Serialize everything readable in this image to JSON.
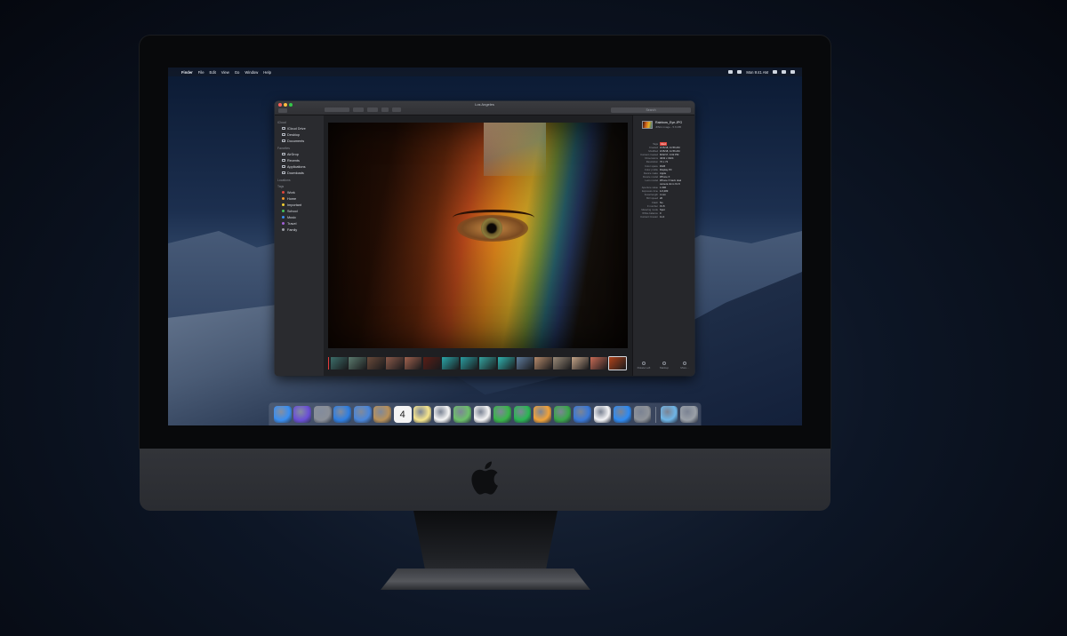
{
  "menubar": {
    "app_name": "Finder",
    "menus": [
      "File",
      "Edit",
      "View",
      "Go",
      "Window",
      "Help"
    ],
    "clock": "Mon 9:41 AM"
  },
  "window": {
    "title": "Los Angeles",
    "search_placeholder": "Search"
  },
  "sidebar": {
    "sections": [
      {
        "heading": "iCloud",
        "items": [
          {
            "label": "iCloud Drive",
            "icon": "cloud-icon"
          },
          {
            "label": "Desktop",
            "icon": "desktop-icon"
          },
          {
            "label": "Documents",
            "icon": "documents-icon"
          }
        ]
      },
      {
        "heading": "Favorites",
        "items": [
          {
            "label": "AirDrop",
            "icon": "airdrop-icon"
          },
          {
            "label": "Recents",
            "icon": "clock-icon"
          },
          {
            "label": "Applications",
            "icon": "applications-icon"
          },
          {
            "label": "Downloads",
            "icon": "download-icon"
          }
        ]
      },
      {
        "heading": "Locations",
        "items": []
      },
      {
        "heading": "Tags",
        "items": [
          {
            "label": "Work",
            "color": "#e0453c"
          },
          {
            "label": "Home",
            "color": "#f0952b"
          },
          {
            "label": "Important",
            "color": "#f2cf32"
          },
          {
            "label": "School",
            "color": "#45c25a"
          },
          {
            "label": "Music",
            "color": "#3a8ef0"
          },
          {
            "label": "Travel",
            "color": "#a15fd6"
          },
          {
            "label": "Family",
            "color": "#9b9ea4"
          }
        ]
      }
    ]
  },
  "thumbnails": [
    {
      "color": "#3c6e6a"
    },
    {
      "color": "#5b7a6e"
    },
    {
      "color": "#6a4a3a"
    },
    {
      "color": "#8b5a4a"
    },
    {
      "color": "#a0624e"
    },
    {
      "color": "#5a1e16"
    },
    {
      "color": "#2aa7a9"
    },
    {
      "color": "#2a9da0"
    },
    {
      "color": "#34a4a0"
    },
    {
      "color": "#30b3b0"
    },
    {
      "color": "#5f7b9c"
    },
    {
      "color": "#b58a6c"
    },
    {
      "color": "#9a8a78"
    },
    {
      "color": "#c4a488"
    },
    {
      "color": "#c76b55"
    },
    {
      "color": "#b0421a",
      "selected": true
    }
  ],
  "info": {
    "filename": "Rainbow_Eye.JPG",
    "subtitle": "JPEG image - 5.6 MB",
    "rows": [
      {
        "key": "Tags",
        "value": "Red",
        "is_tag": true
      },
      {
        "key": "Created",
        "value": "3/15/18, 11:56 AM"
      },
      {
        "key": "Modified",
        "value": "3/15/18, 11:56 AM"
      },
      {
        "key": "Content created",
        "value": "8/22/17, 4:02 PM"
      },
      {
        "key": "Dimensions",
        "value": "4032 x 3024"
      },
      {
        "key": "Resolution",
        "value": "72 x 72"
      },
      {
        "key": "Color space",
        "value": "RGB"
      },
      {
        "key": "Color profile",
        "value": "Display P3"
      },
      {
        "key": "Device make",
        "value": "Apple"
      },
      {
        "key": "Device model",
        "value": "iPhone X"
      },
      {
        "key": "Lens model",
        "value": "iPhone X back dual"
      },
      {
        "key": "",
        "value": "camera 4mm f/1.8"
      },
      {
        "key": "Aperture value",
        "value": "1.696"
      },
      {
        "key": "Exposure time",
        "value": "1/2,283"
      },
      {
        "key": "Focal length",
        "value": "4 mm"
      },
      {
        "key": "ISO speed",
        "value": "20"
      },
      {
        "key": "Flash",
        "value": "No"
      },
      {
        "key": "F number",
        "value": "f/1.8"
      },
      {
        "key": "Metering mode",
        "value": "Spot"
      },
      {
        "key": "White balance",
        "value": "0"
      },
      {
        "key": "Content Creator",
        "value": "11.4"
      }
    ],
    "quick_actions": [
      "Rotate Left",
      "Markup",
      "More..."
    ]
  },
  "dock": {
    "apps": [
      {
        "name": "Finder",
        "color": "#3a8ef0",
        "icon": "finder-icon"
      },
      {
        "name": "Siri",
        "color": "#6a4fd6",
        "icon": "siri-icon"
      },
      {
        "name": "Launchpad",
        "color": "#8a8f98",
        "icon": "rocket-icon"
      },
      {
        "name": "Safari",
        "color": "#2f7ee0",
        "icon": "compass-icon"
      },
      {
        "name": "Mail",
        "color": "#4a86d9",
        "icon": "stamp-icon"
      },
      {
        "name": "Contacts",
        "color": "#b8915a",
        "icon": "contacts-icon"
      },
      {
        "name": "Calendar",
        "color": "#f2f2f2",
        "icon": "calendar-icon"
      },
      {
        "name": "Notes",
        "color": "#f6e58d",
        "icon": "notes-icon"
      },
      {
        "name": "Reminders",
        "color": "#f5f5f5",
        "icon": "list-icon"
      },
      {
        "name": "Maps",
        "color": "#6cbf6a",
        "icon": "map-icon"
      },
      {
        "name": "Photos",
        "color": "#f4f4f4",
        "icon": "flower-icon"
      },
      {
        "name": "Messages",
        "color": "#39b54a",
        "icon": "chat-icon"
      },
      {
        "name": "FaceTime",
        "color": "#2bb553",
        "icon": "video-icon"
      },
      {
        "name": "Pages",
        "color": "#f0a23a",
        "icon": "pen-icon"
      },
      {
        "name": "Numbers",
        "color": "#3aa64a",
        "icon": "bars-icon"
      },
      {
        "name": "Keynote",
        "color": "#3a78d6",
        "icon": "podium-icon"
      },
      {
        "name": "iTunes",
        "color": "#f4f4f6",
        "icon": "music-note-icon"
      },
      {
        "name": "App Store",
        "color": "#2f8af0",
        "icon": "appstore-icon"
      },
      {
        "name": "System Preferences",
        "color": "#8f9399",
        "icon": "gear-icon"
      }
    ],
    "folders": [
      {
        "name": "Folder",
        "color": "#6fb5e6",
        "icon": "folder-icon"
      },
      {
        "name": "Trash",
        "color": "#9aa0a8",
        "icon": "trash-icon"
      }
    ],
    "calendar_day": "4"
  },
  "colors": {
    "screen_accent": "#1c2f4f",
    "window_bg": "#232427",
    "tag_red": "#e0453c"
  }
}
